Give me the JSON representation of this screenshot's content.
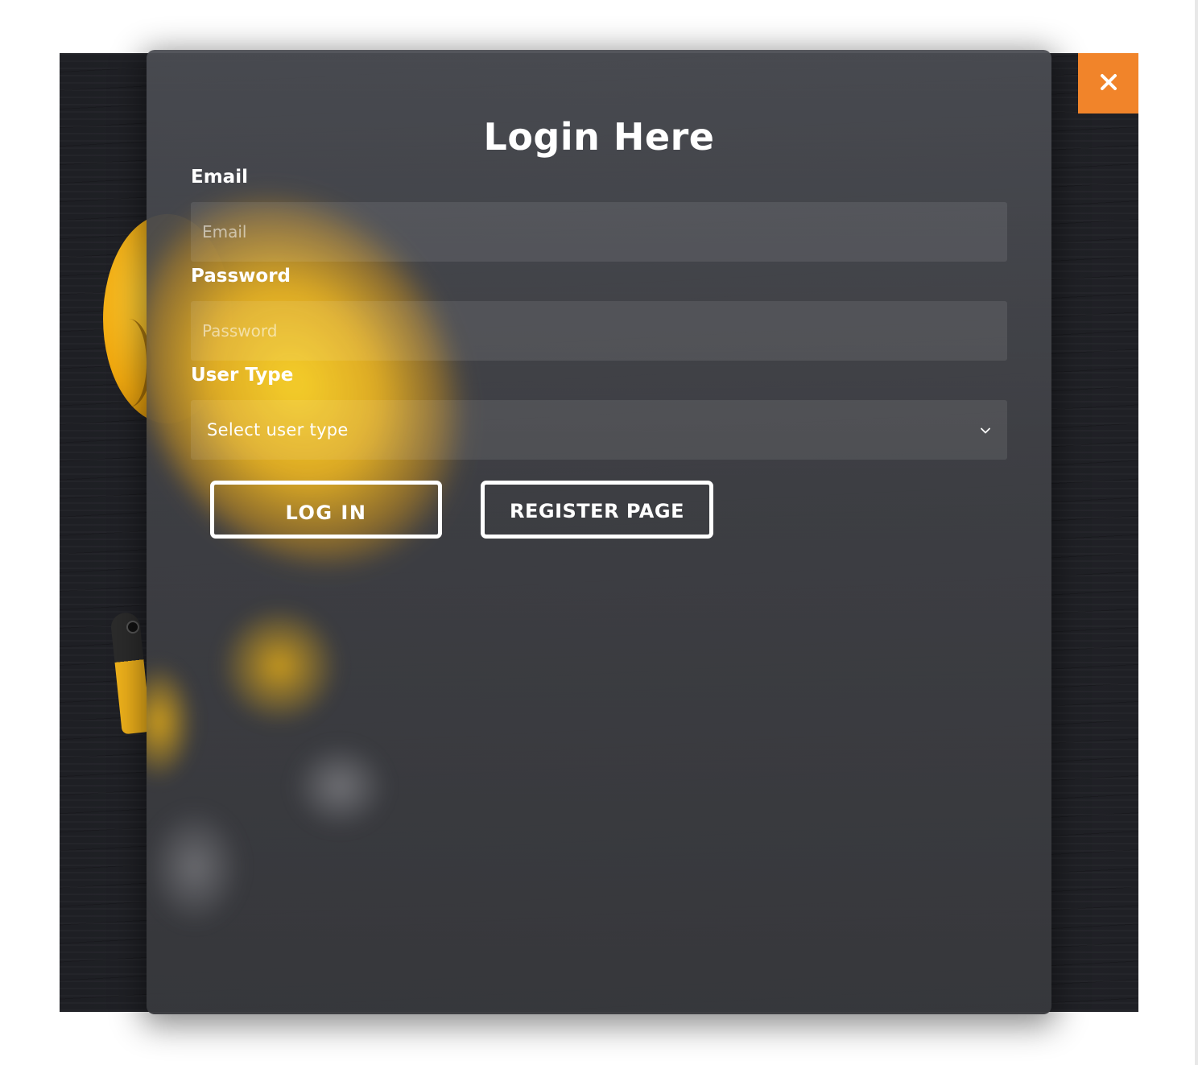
{
  "modal": {
    "title": "Login Here",
    "email": {
      "label": "Email",
      "placeholder": "Email",
      "value": ""
    },
    "password": {
      "label": "Password",
      "placeholder": "Password",
      "value": ""
    },
    "user_type": {
      "label": "User Type",
      "selected": "Select user type"
    },
    "buttons": {
      "login": "LOG IN",
      "register": "REGISTER PAGE"
    }
  },
  "close_button": {
    "icon": "close-icon",
    "color": "#f1842a"
  },
  "colors": {
    "accent": "#f1842a",
    "modal_bg": "#3e3f44",
    "text": "#ffffff"
  }
}
